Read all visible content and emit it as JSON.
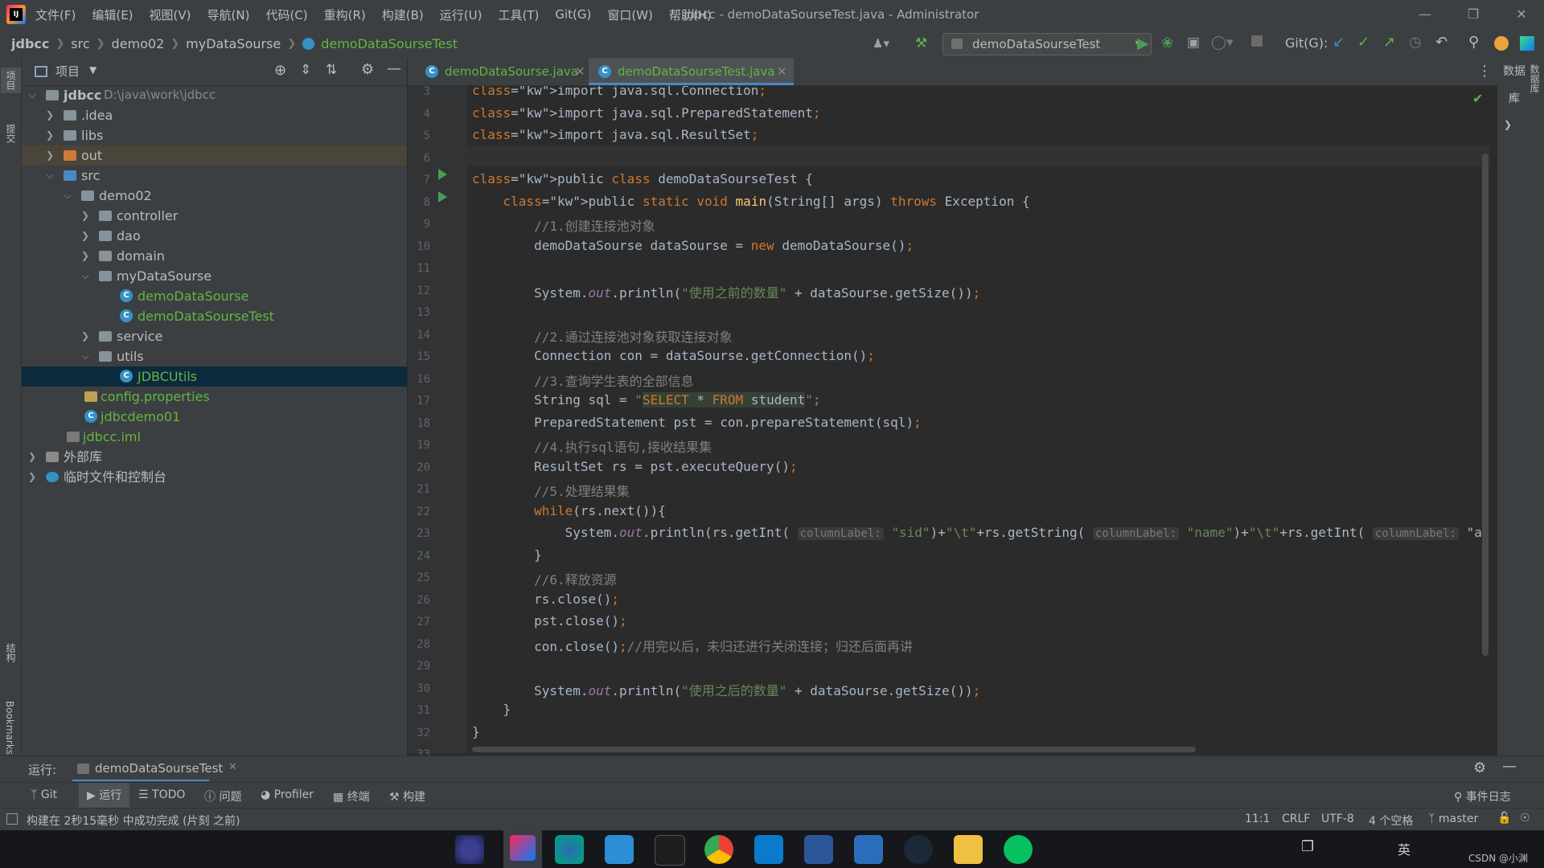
{
  "window": {
    "title": "jdbcc - demoDataSourseTest.java - Administrator",
    "menu": [
      "文件(F)",
      "编辑(E)",
      "视图(V)",
      "导航(N)",
      "代码(C)",
      "重构(R)",
      "构建(B)",
      "运行(U)",
      "工具(T)",
      "Git(G)",
      "窗口(W)",
      "帮助(H)"
    ]
  },
  "breadcrumb": [
    "jdbcc",
    "src",
    "demo02",
    "myDataSourse",
    "demoDataSourseTest"
  ],
  "toolbar": {
    "run_config": "demoDataSourseTest",
    "git_label": "Git(G):"
  },
  "project_panel": {
    "title": "项目",
    "tree": [
      {
        "label": "jdbcc",
        "path": "D:\\java\\work\\jdbcc"
      },
      {
        "label": ".idea"
      },
      {
        "label": "libs"
      },
      {
        "label": "out"
      },
      {
        "label": "src"
      },
      {
        "label": "demo02"
      },
      {
        "label": "controller"
      },
      {
        "label": "dao"
      },
      {
        "label": "domain"
      },
      {
        "label": "myDataSourse"
      },
      {
        "label": "demoDataSourse"
      },
      {
        "label": "demoDataSourseTest"
      },
      {
        "label": "service"
      },
      {
        "label": "utils"
      },
      {
        "label": "JDBCUtils"
      },
      {
        "label": "config.properties"
      },
      {
        "label": "jdbcdemo01"
      },
      {
        "label": "jdbcc.iml"
      },
      {
        "label": "外部库"
      },
      {
        "label": "临时文件和控制台"
      }
    ]
  },
  "left_strip": {
    "project": "项目",
    "commit": "提交",
    "structure": "结构",
    "bookmarks": "Bookmarks"
  },
  "right_strip": {
    "database": "数据库"
  },
  "tabs": [
    "demoDataSourse.java",
    "demoDataSourseTest.java"
  ],
  "code": {
    "line_numbers": [
      "3",
      "4",
      "5",
      "6",
      "7",
      "8",
      "9",
      "10",
      "11",
      "12",
      "13",
      "14",
      "15",
      "16",
      "17",
      "18",
      "19",
      "20",
      "21",
      "22",
      "23",
      "24",
      "25",
      "26",
      "27",
      "28",
      "29",
      "30",
      "31",
      "32",
      "33"
    ],
    "lines": [
      "import java.sql.Connection;",
      "import java.sql.PreparedStatement;",
      "import java.sql.ResultSet;",
      "",
      "public class demoDataSourseTest {",
      "    public static void main(String[] args) throws Exception {",
      "        //1.创建连接池对象",
      "        demoDataSourse dataSourse = new demoDataSourse();",
      "",
      "        System.out.println(\"使用之前的数量\" + dataSourse.getSize());",
      "",
      "        //2.通过连接池对象获取连接对象",
      "        Connection con = dataSourse.getConnection();",
      "        //3.查询学生表的全部信息",
      "        String sql = \"SELECT * FROM student\";",
      "        PreparedStatement pst = con.prepareStatement(sql);",
      "        //4.执行sql语句,接收结果集",
      "        ResultSet rs = pst.executeQuery();",
      "        //5.处理结果集",
      "        while(rs.next()){",
      "            System.out.println(rs.getInt( columnLabel: \"sid\")+\"\\t\"+rs.getString( columnLabel: \"name\")+\"\\t\"+rs.getInt( columnLabel: \"ag",
      "        }",
      "        //6.释放资源",
      "        rs.close();",
      "        pst.close();",
      "        con.close();//用完以后，未归还进行关闭连接；归还后面再讲",
      "",
      "        System.out.println(\"使用之后的数量\" + dataSourse.getSize());",
      "    }",
      "}",
      ""
    ]
  },
  "run_bar": {
    "label": "运行:",
    "tab": "demoDataSourseTest"
  },
  "bottom_tools": [
    "Git",
    "运行",
    "TODO",
    "问题",
    "Profiler",
    "终端",
    "构建"
  ],
  "event_log": "事件日志",
  "status": {
    "message": "构建在 2秒15毫秒 中成功完成 (片刻 之前)",
    "position": "11:1",
    "line_sep": "CRLF",
    "encoding": "UTF-8",
    "indent": "4 个空格",
    "branch": "master"
  },
  "taskbar": {
    "ime": "英",
    "watermark": "CSDN @小渊"
  }
}
